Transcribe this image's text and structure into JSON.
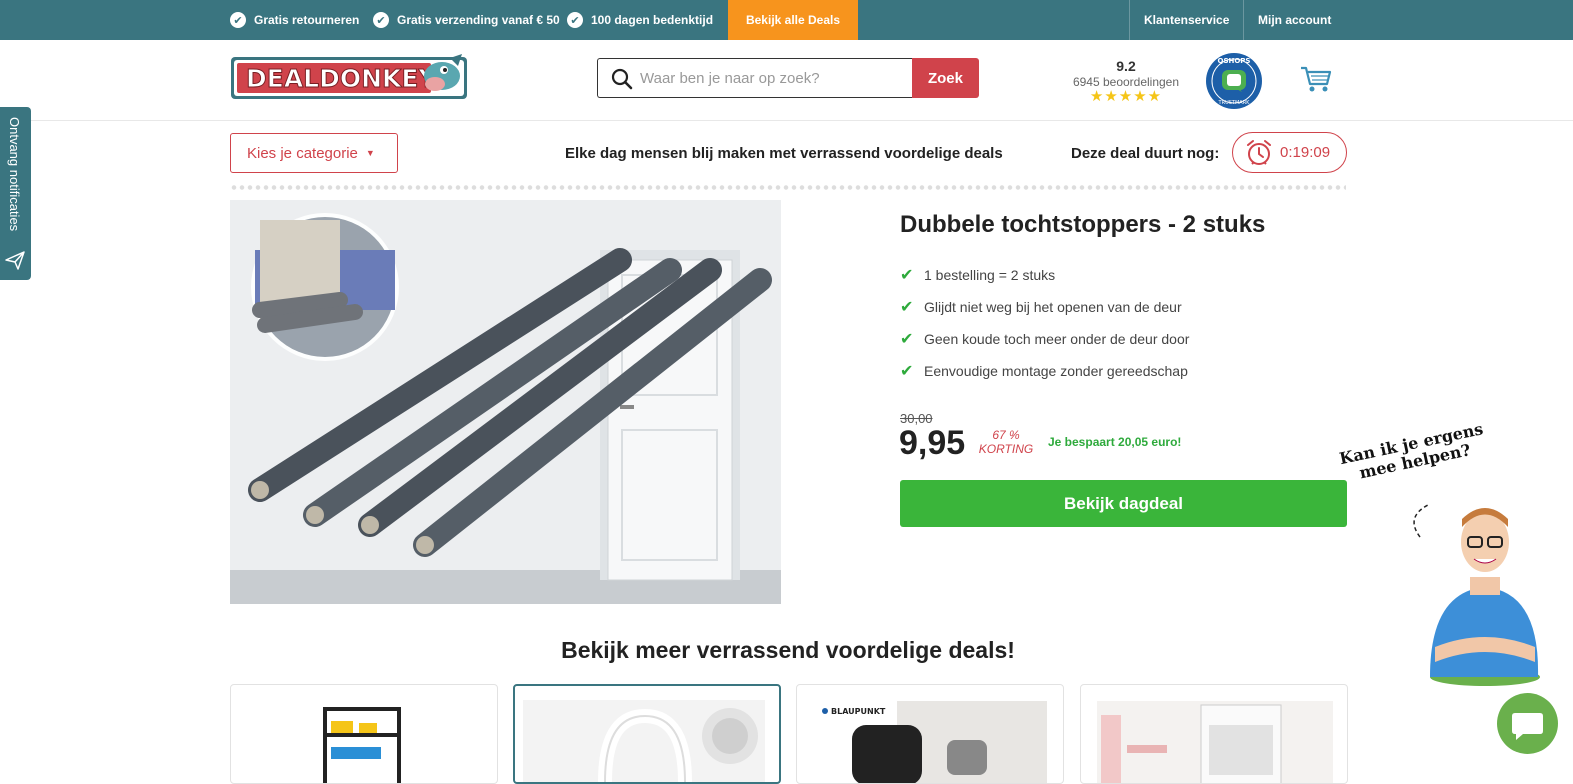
{
  "topbar": {
    "usps": [
      "Gratis retourneren",
      "Gratis verzending vanaf € 50",
      "100 dagen bedenktijd"
    ],
    "deals_button": "Bekijk alle Deals",
    "links": [
      "Klantenservice",
      "Mijn account"
    ]
  },
  "header": {
    "logo_text": "DEALDONKEY",
    "search": {
      "placeholder": "Waar ben je naar op zoek?",
      "button": "Zoek"
    },
    "rating": {
      "score": "9.2",
      "count": "6945 beoordelingen",
      "stars": "★★★★★"
    },
    "trustmark": "QSHOPS TRUSTMARK"
  },
  "subheader": {
    "category_button": "Kies je categorie",
    "tagline": "Elke dag mensen blij maken met verrassend voordelige deals",
    "timer_label": "Deze deal duurt nog:",
    "timer_value": "0:19:09"
  },
  "product": {
    "title": "Dubbele tochtstoppers - 2 stuks",
    "features": [
      "1 bestelling = 2 stuks",
      "Glijdt niet weg bij het openen van de deur",
      "Geen koude toch meer onder de deur door",
      "Eenvoudige montage zonder gereedschap"
    ],
    "old_price": "30,00",
    "price": "9,95",
    "discount_pct": "67 %",
    "discount_label": "KORTING",
    "saving": "Je bespaart 20,05 euro!",
    "cta": "Bekijk dagdeal"
  },
  "more": {
    "title": "Bekijk meer verrassend voordelige deals!",
    "cards": [
      {
        "name": "storage-rack"
      },
      {
        "name": "headphones"
      },
      {
        "name": "smartwatch",
        "brand": "BLAUPUNKT"
      },
      {
        "name": "air-cooler"
      }
    ]
  },
  "notifications_tab": "Ontvang notificaties",
  "help": {
    "text_line1": "Kan ik je ergens",
    "text_line2": "mee helpen?"
  },
  "colors": {
    "teal": "#3a7580",
    "orange": "#f7941d",
    "red": "#d0434b",
    "green": "#3ab53a"
  }
}
